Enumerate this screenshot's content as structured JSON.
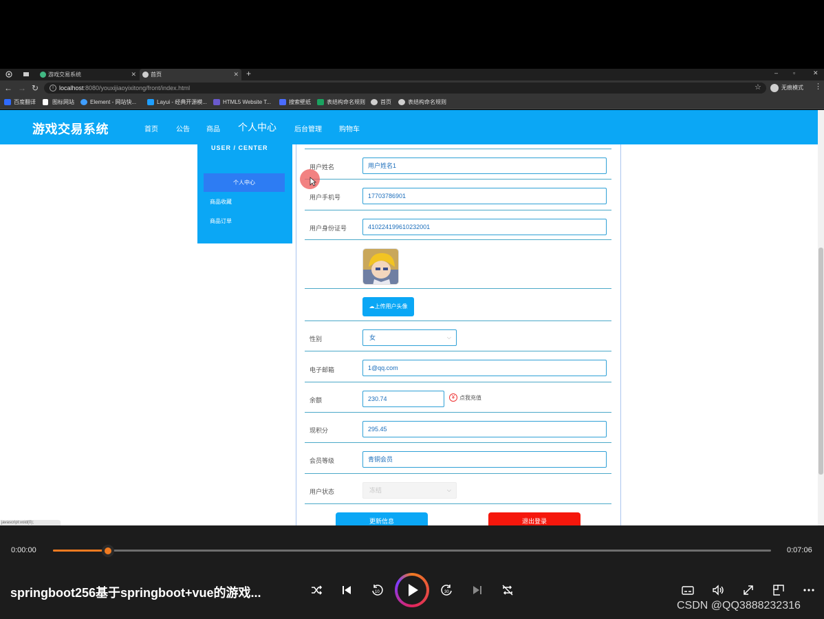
{
  "browser": {
    "tabs": [
      {
        "title": "游戏交易系统",
        "fav_color": "#41b883"
      },
      {
        "title": "首页",
        "fav_color": "#cfcfcf"
      }
    ],
    "url_host": "localhost",
    "url_path": ":8080/youxijiaoyixitong/front/index.html",
    "profile_label": "无痕模式",
    "bookmarks": [
      {
        "label": "百度翻译",
        "color": "#2f6bff"
      },
      {
        "label": "图标网站",
        "color": "#ffffff"
      },
      {
        "label": "Element - 网站快...",
        "color": "#409eff"
      },
      {
        "label": "Layui - 经典开源模...",
        "color": "#1e9fff"
      },
      {
        "label": "HTML5 Website T...",
        "color": "#6a5acd"
      },
      {
        "label": "搜索壁纸",
        "color": "#4a6cff"
      },
      {
        "label": "表结构命名规则",
        "color": "#1aa260"
      },
      {
        "label": "首页",
        "color": "#cfcfcf"
      },
      {
        "label": "表结构命名规则",
        "color": "#cfcfcf"
      }
    ]
  },
  "site": {
    "logo": "游戏交易系统",
    "nav": [
      "首页",
      "公告",
      "商品",
      "个人中心",
      "后台管理",
      "购物车"
    ]
  },
  "sidebar": {
    "title": "USER / CENTER",
    "items": [
      "个人中心",
      "商品收藏",
      "商品订单"
    ]
  },
  "form": {
    "name_label": "用户姓名",
    "name_value": "用户姓名1",
    "phone_label": "用户手机号",
    "phone_value": "17703786901",
    "idcard_label": "用户身份证号",
    "idcard_value": "410224199610232001",
    "upload_button": "上传用户头像",
    "gender_label": "性别",
    "gender_value": "女",
    "email_label": "电子邮箱",
    "email_value": "1@qq.com",
    "balance_label": "余额",
    "balance_value": "230.74",
    "recharge_link": "点我充值",
    "points_label": "现积分",
    "points_value": "295.45",
    "level_label": "会员等级",
    "level_value": "青铜会员",
    "status_label": "用户状态",
    "status_value": "冻结",
    "update_button": "更新信息",
    "logout_button": "退出登录"
  },
  "statusbar": {
    "link": "javascript:void(0);"
  },
  "player": {
    "current_time": "0:00:00",
    "duration": "0:07:06",
    "progress_fraction": 0.077,
    "title": "springboot256基于springboot+vue的游戏...",
    "watermark": "CSDN @QQ3888232316",
    "accent_color": "#f07b21"
  }
}
